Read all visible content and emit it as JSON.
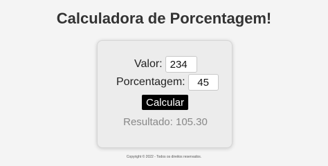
{
  "header": {
    "title": "Calculadora de Porcentagem!"
  },
  "form": {
    "valor_label": "Valor:",
    "valor_value": "234",
    "porcentagem_label": "Porcentagem:",
    "porcentagem_value": "45",
    "calcular_label": "Calcular",
    "resultado_text": "Resultado: 105.30"
  },
  "footer": {
    "text": "Copyright © 2022 - Todos os direitos reservados."
  },
  "colors": {
    "background": "#f4f4f4",
    "card": "#ececec",
    "button": "#000000",
    "result_text": "#888888"
  }
}
